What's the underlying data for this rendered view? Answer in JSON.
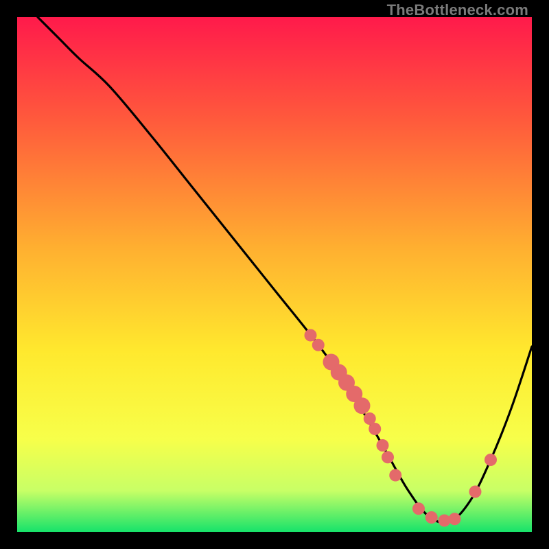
{
  "watermark": "TheBottleneck.com",
  "chart_data": {
    "type": "line",
    "title": "",
    "xlabel": "",
    "ylabel": "",
    "xlim": [
      0,
      100
    ],
    "ylim": [
      0,
      100
    ],
    "grid": false,
    "legend": false,
    "gradient_stops": [
      {
        "offset": 0,
        "color": "#ff1a4b"
      },
      {
        "offset": 20,
        "color": "#ff5a3c"
      },
      {
        "offset": 45,
        "color": "#ffb030"
      },
      {
        "offset": 65,
        "color": "#ffe92e"
      },
      {
        "offset": 82,
        "color": "#f7ff4a"
      },
      {
        "offset": 92,
        "color": "#c8ff66"
      },
      {
        "offset": 100,
        "color": "#17e36a"
      }
    ],
    "series": [
      {
        "name": "bottleneck-curve",
        "x": [
          4,
          8,
          12,
          18,
          26,
          34,
          42,
          50,
          58,
          63,
          68,
          72,
          76,
          80,
          84,
          88,
          92,
          96,
          100
        ],
        "y": [
          100,
          96,
          92,
          86.5,
          77,
          67,
          57,
          47,
          37,
          30,
          22,
          15,
          8,
          3,
          2,
          6,
          14,
          24,
          36
        ]
      }
    ],
    "markers": {
      "name": "highlight-dots",
      "color": "#e46a6a",
      "radius": 9,
      "points": [
        {
          "x": 57,
          "y": 38.2
        },
        {
          "x": 58.5,
          "y": 36.3
        },
        {
          "x": 61,
          "y": 33.0,
          "r": 12
        },
        {
          "x": 62.5,
          "y": 31.0,
          "r": 12
        },
        {
          "x": 64,
          "y": 29.0,
          "r": 12
        },
        {
          "x": 65.5,
          "y": 26.8,
          "r": 12
        },
        {
          "x": 67,
          "y": 24.5,
          "r": 12
        },
        {
          "x": 68.5,
          "y": 22.0
        },
        {
          "x": 69.5,
          "y": 20.0
        },
        {
          "x": 71,
          "y": 16.8
        },
        {
          "x": 72,
          "y": 14.5
        },
        {
          "x": 73.5,
          "y": 11.0
        },
        {
          "x": 78,
          "y": 4.5
        },
        {
          "x": 80.5,
          "y": 2.8
        },
        {
          "x": 83,
          "y": 2.2
        },
        {
          "x": 85,
          "y": 2.5
        },
        {
          "x": 89,
          "y": 7.8
        },
        {
          "x": 92,
          "y": 14.0
        }
      ]
    }
  }
}
